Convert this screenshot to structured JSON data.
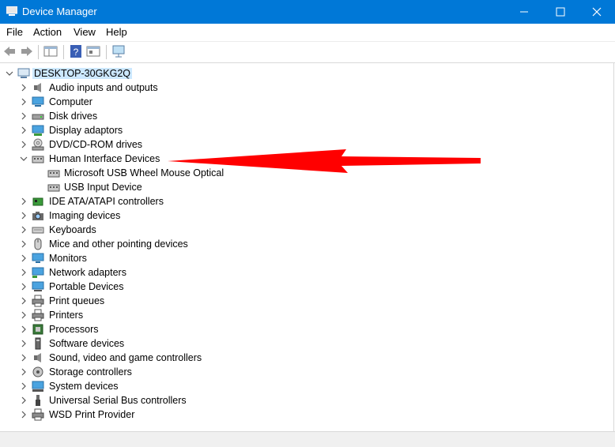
{
  "window": {
    "title": "Device Manager"
  },
  "menu": [
    "File",
    "Action",
    "View",
    "Help"
  ],
  "tree": {
    "root": "DESKTOP-30GKG2Q",
    "categories": [
      "Audio inputs and outputs",
      "Computer",
      "Disk drives",
      "Display adaptors",
      "DVD/CD-ROM drives",
      "Human Interface Devices",
      "IDE ATA/ATAPI controllers",
      "Imaging devices",
      "Keyboards",
      "Mice and other pointing devices",
      "Monitors",
      "Network adapters",
      "Portable Devices",
      "Print queues",
      "Printers",
      "Processors",
      "Software devices",
      "Sound, video and game controllers",
      "Storage controllers",
      "System devices",
      "Universal Serial Bus controllers",
      "WSD Print Provider"
    ],
    "hid_children": [
      "Microsoft USB Wheel Mouse Optical",
      "USB Input Device"
    ]
  },
  "colors": {
    "titlebar": "#0078d7",
    "selection": "#cce8ff",
    "annotation_arrow": "#ff0000"
  }
}
